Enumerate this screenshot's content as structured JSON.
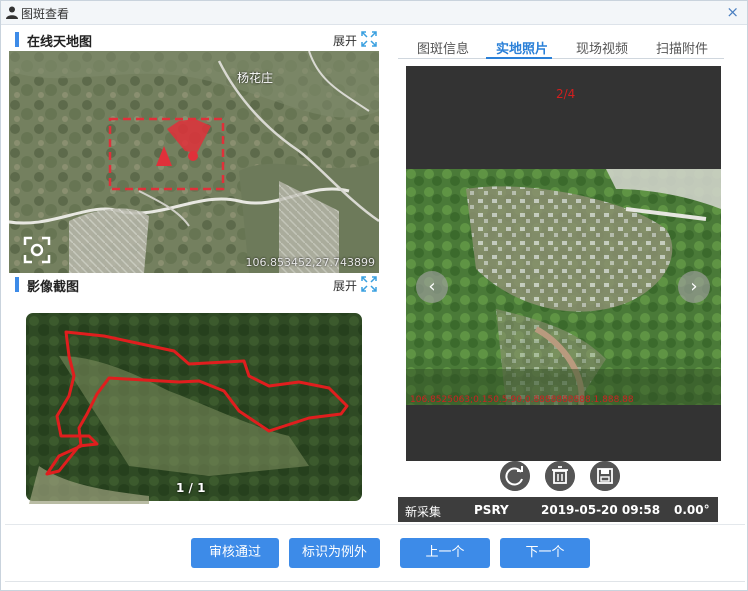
{
  "window": {
    "title": "图斑查看",
    "close_glyph": "×",
    "title_icon": "user-icon",
    "close_icon": "close-icon"
  },
  "online_map": {
    "title": "在线天地图",
    "expand_label": "展开",
    "expand_icon": "expand-arrows-icon",
    "place_label": "杨花庄",
    "coordinates": "106.853452,27.743899",
    "locate_icon": "locate-icon",
    "marker_color": "#e0303a"
  },
  "image_crop": {
    "title": "影像截图",
    "expand_label": "展开",
    "expand_icon": "expand-arrows-icon",
    "page_indicator": "1 / 1",
    "boundary_color": "#e01e1e"
  },
  "tabs": [
    {
      "label": "图斑信息",
      "active": false
    },
    {
      "label": "实地照片",
      "active": true
    },
    {
      "label": "现场视频",
      "active": false
    },
    {
      "label": "扫描附件",
      "active": false
    }
  ],
  "photo_viewer": {
    "counter": "2/4",
    "prev_glyph": "‹",
    "next_glyph": "›",
    "prev_icon": "chevron-left-icon",
    "next_icon": "chevron-right-icon",
    "overlay_text": "106.8525063;0.150.5:90.0.8888888888.1.888.88",
    "action_icons": [
      "rotate-icon",
      "trash-icon",
      "save-icon"
    ]
  },
  "photo_info": {
    "status": "新采集",
    "code": "PSRY",
    "timestamp": "2019-05-20 09:58",
    "angle": "0.00°"
  },
  "buttons": {
    "approve": "审核通过",
    "mark_exception": "标识为例外",
    "previous": "上一个",
    "next": "下一个"
  },
  "colors": {
    "accent": "#3d8be8",
    "tab_active": "#2a80d8",
    "counter_red": "#d21e1e"
  }
}
